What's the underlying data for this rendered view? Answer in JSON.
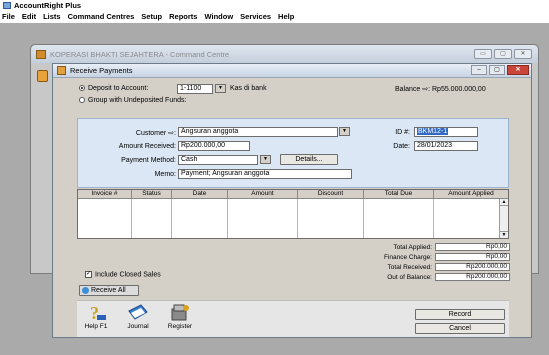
{
  "app": {
    "title": "AccountRight Plus",
    "menu": [
      "File",
      "Edit",
      "Lists",
      "Command Centres",
      "Setup",
      "Reports",
      "Window",
      "Services",
      "Help"
    ]
  },
  "command_centre": {
    "title": "KOPERASI BHAKTI SEJAHTERA - Command Centre",
    "controls": [
      "▭",
      "▢",
      "✕"
    ]
  },
  "receive_payments": {
    "title": "Receive Payments",
    "controls": [
      "–",
      "▢",
      "✕"
    ],
    "deposit_label": "Deposit to Account:",
    "deposit_account": "1-1100",
    "deposit_account_name": "Kas di bank",
    "group_label": "Group with Undeposited Funds:",
    "balance": "Balance ⇨:  Rp55.000.000,00",
    "customer_label": "Customer ⇨:",
    "customer_value": "Angsuran anggota",
    "amount_label": "Amount Received:",
    "amount_value": "Rp200.000,00",
    "payment_method_label": "Payment Method:",
    "payment_method_value": "Cash",
    "details_button": "Details...",
    "memo_label": "Memo:",
    "memo_value": "Payment; Angsuran anggota",
    "id_label": "ID #:",
    "id_value": "BKM12-1",
    "date_label": "Date:",
    "date_value": "28/01/2023",
    "grid_columns": [
      "Invoice #",
      "Status",
      "Date",
      "Amount",
      "Discount",
      "Total Due",
      "Amount Applied"
    ],
    "totals": [
      {
        "label": "Total Applied:",
        "value": "Rp0,00"
      },
      {
        "label": "Finance Charge:",
        "value": "Rp0,00"
      },
      {
        "label": "Total Received:",
        "value": "Rp200.000,00"
      },
      {
        "label": "Out of Balance:",
        "value": "Rp200.000,00"
      }
    ],
    "include_closed_sales": "Include Closed Sales",
    "receive_all": "Receive All",
    "tools": [
      "Help F1",
      "Journal",
      "Register"
    ],
    "record_button": "Record",
    "cancel_button": "Cancel"
  }
}
